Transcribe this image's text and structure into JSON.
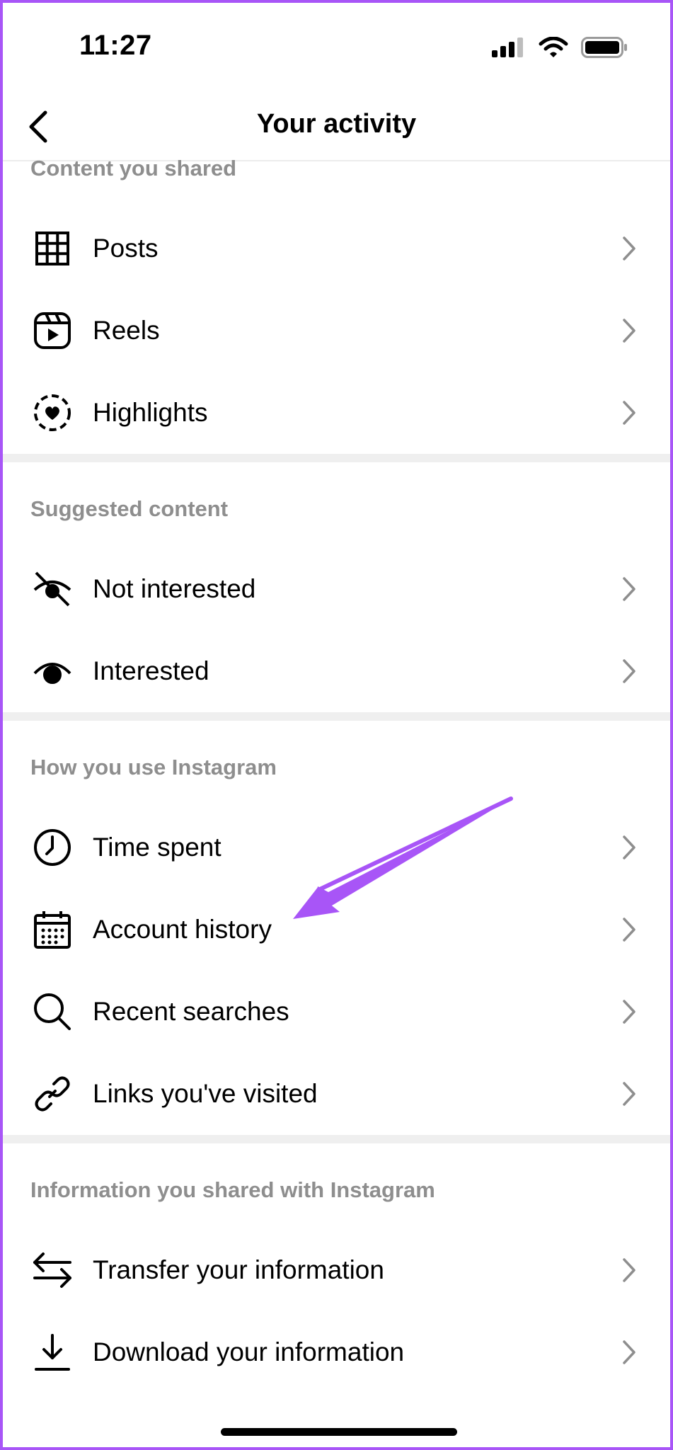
{
  "status_bar": {
    "time": "11:27"
  },
  "header": {
    "title": "Your activity"
  },
  "sections": [
    {
      "title": "Content you shared",
      "items": [
        {
          "label": "Posts",
          "icon": "grid-icon"
        },
        {
          "label": "Reels",
          "icon": "reels-icon"
        },
        {
          "label": "Highlights",
          "icon": "highlights-icon"
        }
      ]
    },
    {
      "title": "Suggested content",
      "items": [
        {
          "label": "Not interested",
          "icon": "eye-slash-icon"
        },
        {
          "label": "Interested",
          "icon": "eye-icon"
        }
      ]
    },
    {
      "title": "How you use Instagram",
      "items": [
        {
          "label": "Time spent",
          "icon": "clock-icon"
        },
        {
          "label": "Account history",
          "icon": "calendar-icon"
        },
        {
          "label": "Recent searches",
          "icon": "search-icon"
        },
        {
          "label": "Links you've visited",
          "icon": "link-icon"
        }
      ]
    },
    {
      "title": "Information you shared with Instagram",
      "items": [
        {
          "label": "Transfer your information",
          "icon": "transfer-icon"
        },
        {
          "label": "Download your information",
          "icon": "download-icon"
        }
      ]
    }
  ],
  "colors": {
    "accent_arrow": "#a855f7",
    "section_header": "#8e8e8e",
    "divider": "#efefef",
    "chevron": "#8e8e8e"
  }
}
